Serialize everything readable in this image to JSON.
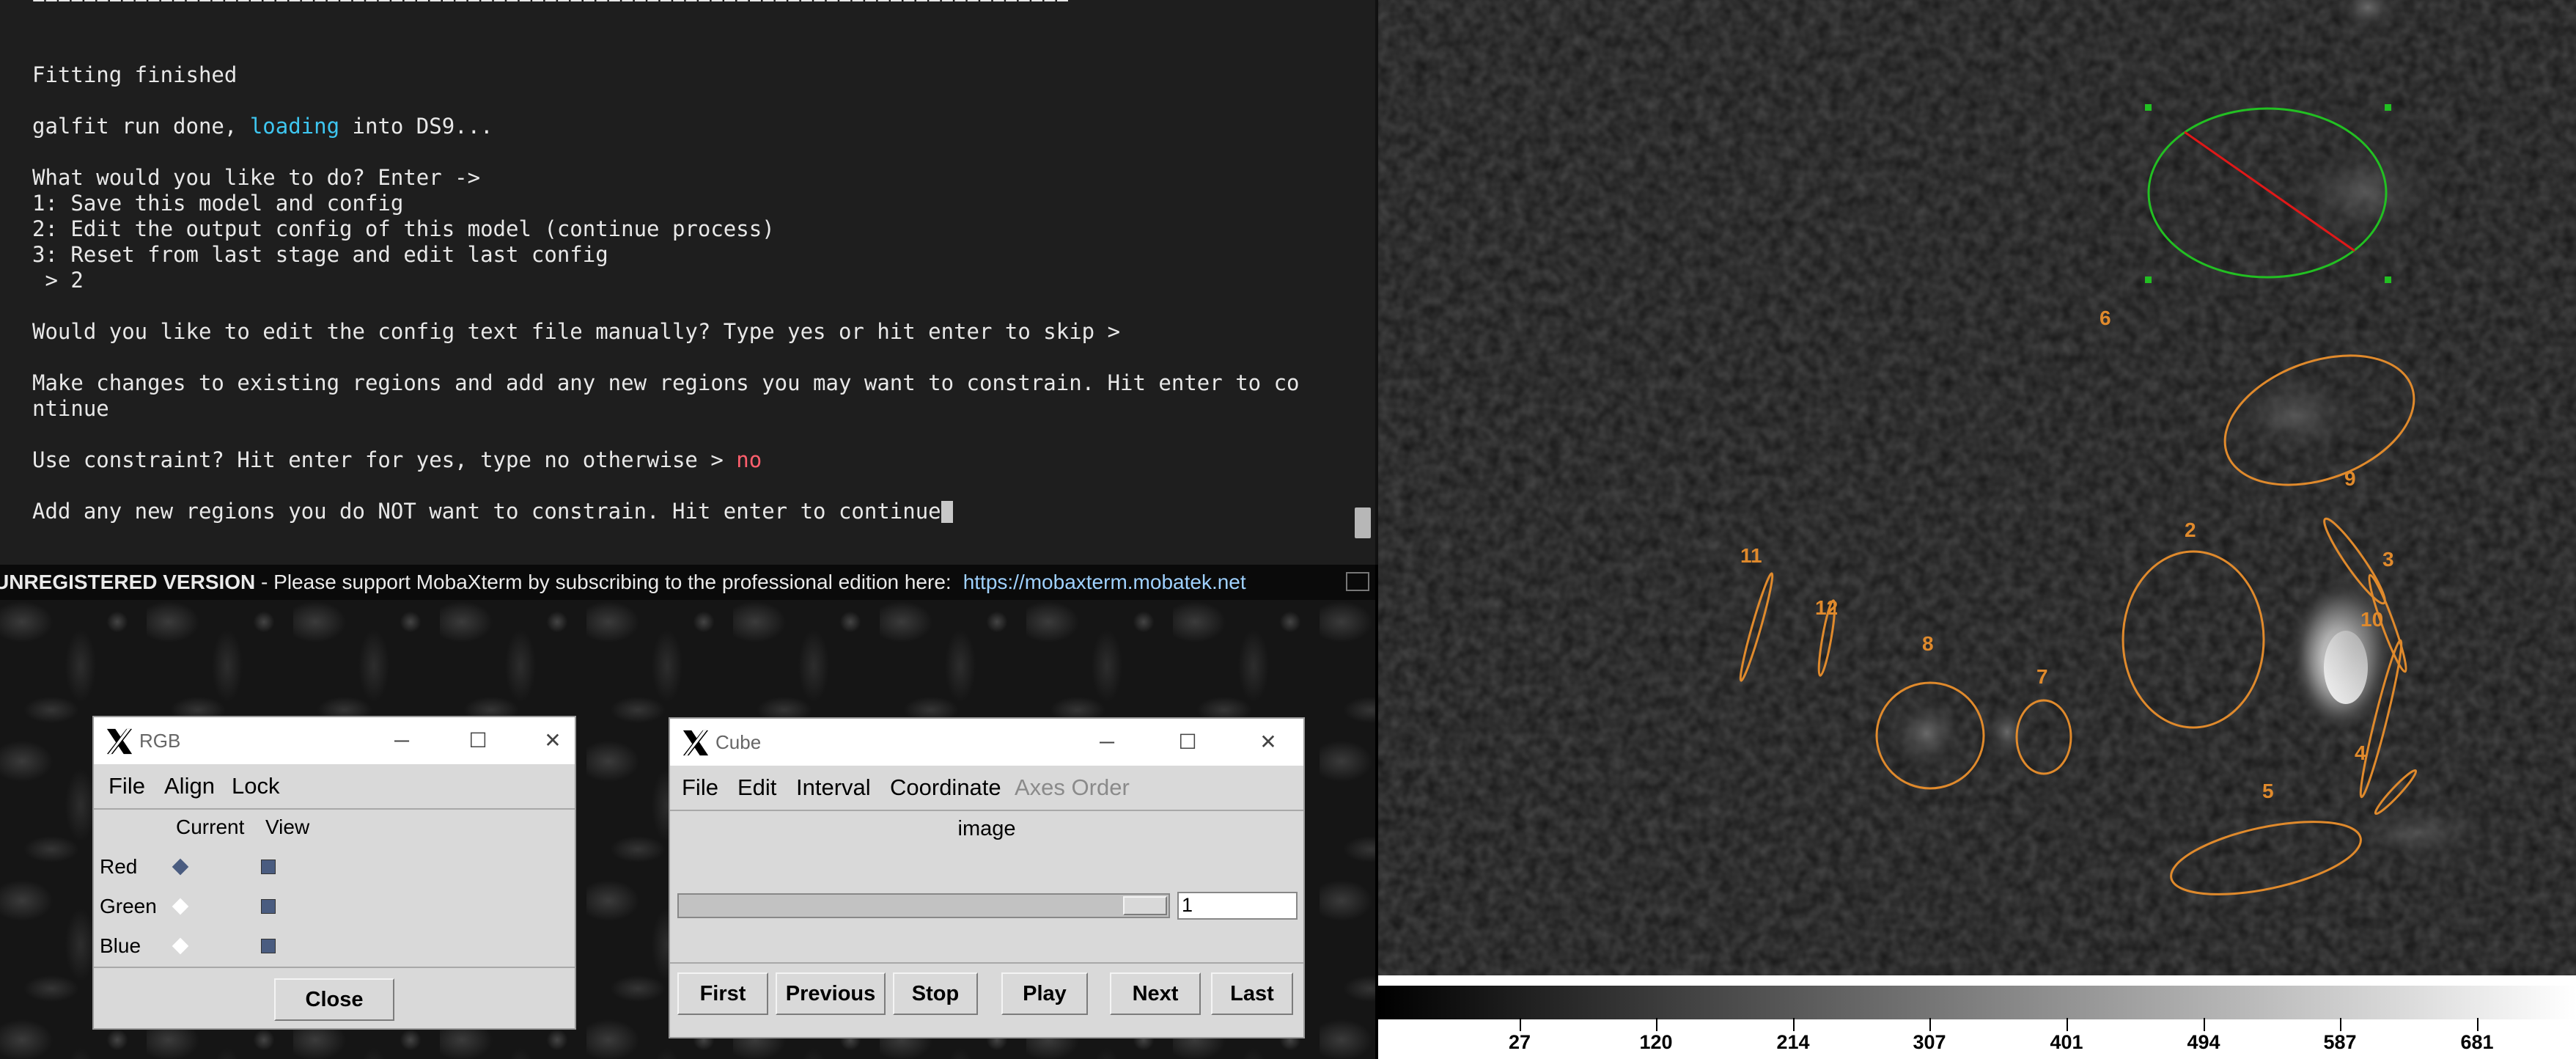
{
  "terminal": {
    "divider": "=================================================================================",
    "lines": {
      "l1": "Fitting finished",
      "l2a": "galfit run done, ",
      "l2b": "loading",
      "l2c": " into DS9...",
      "l3": "What would you like to do? Enter ->",
      "l4": "1: Save this model and config",
      "l5": "2: Edit the output config of this model (continue process)",
      "l6": "3: Reset from last stage and edit last config",
      "l7": " > 2",
      "l8": "Would you like to edit the config text file manually? Type yes or hit enter to skip >",
      "l9": "Make changes to existing regions and add any new regions you may want to constrain. Hit enter to co",
      "l10": "ntinue",
      "l11a": "Use constraint? Hit enter for yes, type no otherwise > ",
      "l11b": "no",
      "l12": "Add any new regions you do NOT want to constrain. Hit enter to continue"
    }
  },
  "statusbar": {
    "registration": "UNREGISTERED VERSION",
    "message": "  -  Please support MobaXterm by subscribing to the professional edition here:",
    "link": "https://mobaxterm.mobatek.net"
  },
  "rgb_window": {
    "title": "RGB",
    "menu": [
      "File",
      "Align",
      "Lock"
    ],
    "col_current": "Current",
    "col_view": "View",
    "rows": [
      {
        "label": "Red",
        "current": true,
        "view": true
      },
      {
        "label": "Green",
        "current": false,
        "view": true
      },
      {
        "label": "Blue",
        "current": false,
        "view": true
      }
    ],
    "close_label": "Close"
  },
  "cube_window": {
    "title": "Cube",
    "menu": [
      "File",
      "Edit",
      "Interval",
      "Coordinate",
      "Axes Order"
    ],
    "image_label": "image",
    "slice_value": "1",
    "buttons": [
      "First",
      "Previous",
      "Stop",
      "Play",
      "Next",
      "Last"
    ]
  },
  "window_controls": {
    "minimize": "─",
    "maximize": "☐",
    "close": "✕"
  },
  "ds9": {
    "region_labels": [
      "6",
      "9",
      "2",
      "3",
      "10",
      "11",
      "12",
      "8",
      "7",
      "4",
      "5"
    ],
    "colorbar_ticks": [
      "27",
      "120",
      "214",
      "307",
      "401",
      "494",
      "587",
      "681"
    ],
    "colors": {
      "region": "#e08a2c",
      "selected_region": "#22c022",
      "selected_line": "#e01818"
    }
  }
}
